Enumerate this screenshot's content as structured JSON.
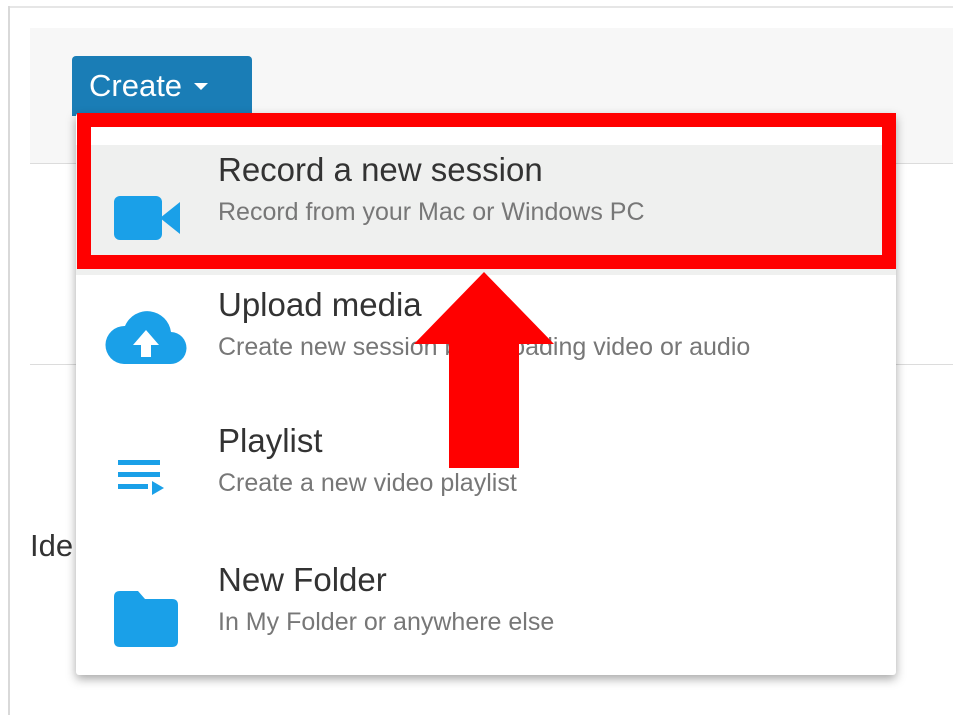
{
  "toolbar": {
    "create_label": "Create"
  },
  "background": {
    "partial_text": "Ide"
  },
  "menu": {
    "items": [
      {
        "title": "Record a new session",
        "desc": "Record from your Mac or Windows PC",
        "icon": "video-camera-icon"
      },
      {
        "title": "Upload media",
        "desc": "Create new session by uploading video or audio",
        "icon": "cloud-upload-icon"
      },
      {
        "title": "Playlist",
        "desc": "Create a new video playlist",
        "icon": "playlist-icon"
      },
      {
        "title": "New Folder",
        "desc": "In My Folder or anywhere else",
        "icon": "folder-icon"
      }
    ]
  },
  "colors": {
    "accent": "#1a7db6",
    "icon": "#1aa0e8",
    "annotation": "#ff0000"
  }
}
